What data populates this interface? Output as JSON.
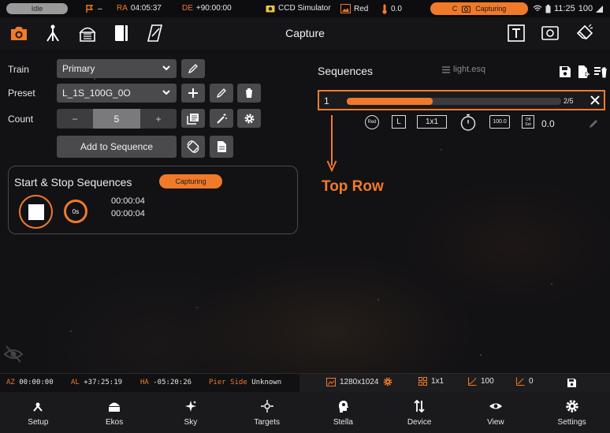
{
  "colors": {
    "accent": "#f07a2a",
    "background": "#121114",
    "panel": "#4a4a4c"
  },
  "status_bar": {
    "idle": "Idle",
    "flag_value": "–",
    "ra_label": "RA",
    "ra_value": "04:05:37",
    "de_label": "DE",
    "de_value": "+90:00:00",
    "camera_name": "CCD Simulator",
    "filter": "Red",
    "temperature": "0.0",
    "capturing": "Capturing",
    "time": "11:25",
    "battery": "100"
  },
  "toolbar": {
    "title": "Capture"
  },
  "left": {
    "train_label": "Train",
    "train_value": "Primary",
    "preset_label": "Preset",
    "preset_value": "L_1S_100G_0O",
    "count_label": "Count",
    "count_minus": "−",
    "count_value": "5",
    "count_plus": "+",
    "add_to_sequence": "Add to Sequence"
  },
  "start_stop": {
    "title": "Start & Stop Sequences",
    "capturing_badge": "Capturing",
    "timer_label": "0s",
    "elapsed_1": "00:00:04",
    "elapsed_2": "00:00:04"
  },
  "sequences": {
    "title": "Sequences",
    "file_name": "light.esq",
    "rows": [
      {
        "index": "1",
        "progress_fraction": 0.4,
        "count_text": "2/5",
        "filter": "Red",
        "type": "L",
        "binning": "1x1",
        "exposure_icon": "stopwatch-icon",
        "gain": "100.0",
        "offset": "Off Set",
        "value": "0.0"
      }
    ]
  },
  "annotation": {
    "text": "Top Row"
  },
  "info_bar": {
    "az_label": "AZ",
    "az_value": "00:00:00",
    "al_label": "AL",
    "al_value": "+37:25:19",
    "ha_label": "HA",
    "ha_value": "-05:20:26",
    "pier_label": "Pier Side",
    "pier_value": "Unknown",
    "resolution": "1280x1024",
    "binning": "1x1",
    "gain": "100",
    "offset": "0"
  },
  "bottom_nav": [
    "Setup",
    "Ekos",
    "Sky",
    "Targets",
    "Stella",
    "Device",
    "View",
    "Settings"
  ]
}
